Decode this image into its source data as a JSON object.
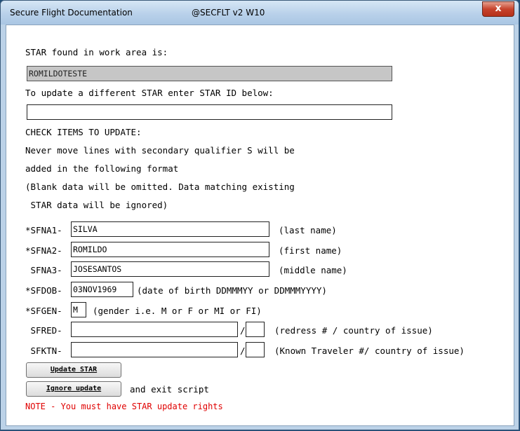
{
  "window": {
    "title": "Secure Flight Documentation",
    "subtitle": "@SECFLT v2 W10",
    "close_glyph": "x"
  },
  "text": {
    "star_found": "STAR found in work area is:",
    "update_diff": "To update a different STAR enter STAR ID below:",
    "check_items": "CHECK ITEMS TO UPDATE:",
    "never_move_1": "Never move lines with secondary qualifier S will be",
    "never_move_2": "added in the following format",
    "blank_1": "(Blank data will be omitted. Data matching existing",
    "blank_2": " STAR data will be ignored)",
    "and_exit": "and exit script",
    "note": "NOTE - You must have STAR update rights"
  },
  "fields": {
    "star_current": "ROMILDOTESTE",
    "star_new": "",
    "sfna1": {
      "label": "*SFNA1-",
      "value": "SILVA",
      "hint": "(last name)"
    },
    "sfna2": {
      "label": "*SFNA2-",
      "value": "ROMILDO",
      "hint": "(first name)"
    },
    "sfna3": {
      "label": " SFNA3-",
      "value": "JOSESANTOS",
      "hint": "(middle name)"
    },
    "sfdob": {
      "label": "*SFDOB-",
      "value": "03NOV1969",
      "hint": "(date of birth DDMMMYY or DDMMMYYYY)"
    },
    "sfgen": {
      "label": "*SFGEN-",
      "value": "M",
      "hint": "(gender i.e. M or F or MI or FI)"
    },
    "sfred": {
      "label": " SFRED-",
      "value": "",
      "country": "",
      "hint": "(redress # / country of issue)"
    },
    "sfktn": {
      "label": " SFKTN-",
      "value": "",
      "country": "",
      "hint": "(Known Traveler #/ country of issue)"
    },
    "slash": "/"
  },
  "buttons": {
    "update_star": "Update STAR",
    "ignore_update": "Ignore update"
  }
}
